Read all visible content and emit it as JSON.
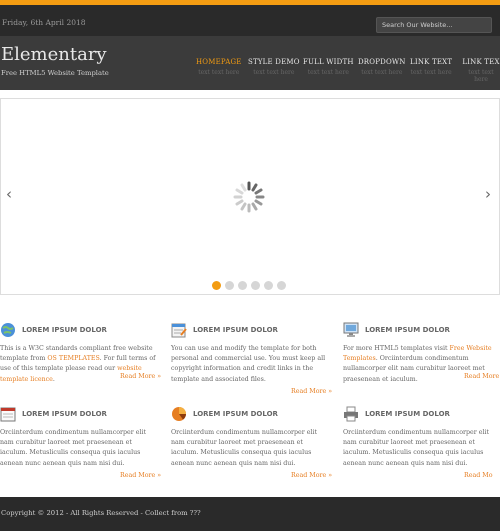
{
  "topbar": {
    "date": "Friday, 6th April 2018",
    "search_placeholder": "Search Our Website..."
  },
  "header": {
    "logo": "Elementary",
    "tagline": "Free HTML5 Website Template"
  },
  "nav": [
    {
      "label": "HOMEPAGE",
      "sub": "text text here"
    },
    {
      "label": "STYLE DEMO",
      "sub": "text text here"
    },
    {
      "label": "FULL WIDTH",
      "sub": "text text here"
    },
    {
      "label": "DROPDOWN",
      "sub": "text text here"
    },
    {
      "label": "LINK TEXT",
      "sub": "text text here"
    },
    {
      "label": "LINK TEX",
      "sub": "text text here"
    }
  ],
  "slider": {
    "prev": "‹",
    "next": "›",
    "dot_count": 6,
    "active_dot": 0
  },
  "blocks": [
    {
      "icon": "globe-icon",
      "title": "LOREM IPSUM DOLOR",
      "text_before": "This is a W3C standards compliant free website template from ",
      "link1": "OS TEMPLATES",
      "text_middle": ". For full terms of use of this template please read our ",
      "link2": "website template licence",
      "text_after": ".",
      "more": "Read More »"
    },
    {
      "icon": "edit-document-icon",
      "title": "LOREM IPSUM DOLOR",
      "text": "You can use and modify the template for both personal and commercial use. You must keep all copyright information and credit links in the template and associated files.",
      "more": "Read More »"
    },
    {
      "icon": "monitor-icon",
      "title": "LOREM IPSUM DOLOR",
      "text_before": "For more HTML5 templates visit ",
      "link1": "Free Website Templates",
      "text_after": ". Orciinterdum condimentum nullamcorper elit nam curabitur laoreet met praesenean et iaculum.",
      "more": "Read More"
    },
    {
      "icon": "calendar-icon",
      "title": "LOREM IPSUM DOLOR",
      "text": "Orciinterdum condimentum nullamcorper elit nam curabitur laoreet met praesenean et iaculum. Metusliculis consequa quis iaculus aenean nunc aenean quis nam nisi dui.",
      "more": "Read More »"
    },
    {
      "icon": "pie-chart-icon",
      "title": "LOREM IPSUM DOLOR",
      "text": "Orciinterdum condimentum nullamcorper elit nam curabitur laoreet met praesenean et iaculum. Metusliculis consequa quis iaculus aenean nunc aenean quis nam nisi dui.",
      "more": "Read More »"
    },
    {
      "icon": "printer-icon",
      "title": "LOREM IPSUM DOLOR",
      "text": "Orciinterdum condimentum nullamcorper elit nam curabitur laoreet met praesenean et iaculum. Metusliculis consequa quis iaculus aenean nunc aenean quis nam nisi dui.",
      "more": "Read Mo"
    }
  ],
  "footer": {
    "copyright": "Copyright © 2012 - All Rights Reserved - Collect from ???"
  },
  "colors": {
    "accent": "#f39c12",
    "dark": "#2a2a2a",
    "header": "#3b3b3b"
  }
}
